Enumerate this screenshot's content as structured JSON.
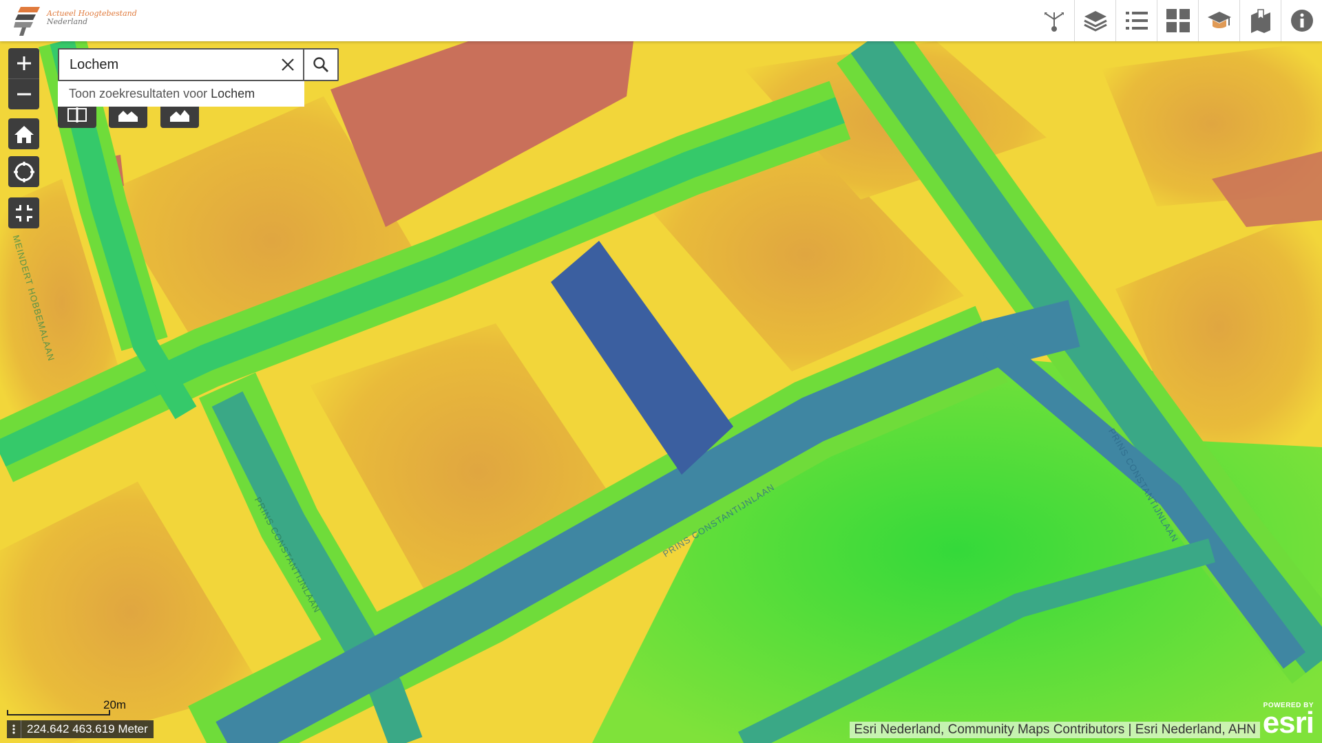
{
  "app": {
    "logo_line1": "Actueel Hoogtebestand",
    "logo_line2": "Nederland"
  },
  "toolbar": [
    {
      "name": "share-icon",
      "label": "Delen"
    },
    {
      "name": "layers-icon",
      "label": "Lagen"
    },
    {
      "name": "legend-icon",
      "label": "Legenda"
    },
    {
      "name": "basemap-gallery-icon",
      "label": "Basiskaarten"
    },
    {
      "name": "education-icon",
      "label": "Educatie"
    },
    {
      "name": "bookmark-icon",
      "label": "Bladwijzers"
    },
    {
      "name": "info-icon",
      "label": "Info"
    }
  ],
  "search": {
    "value": "Lochem",
    "suggestion_prefix": "Toon zoekresultaten voor",
    "suggestion_term": "Lochem"
  },
  "map": {
    "scale_label": "20m",
    "coordinates": "224.642 463.619 Meter",
    "attribution": "Esri Nederland, Community Maps Contributors | Esri Nederland, AHN",
    "powered_by": "POWERED BY",
    "esri_logo": "esri",
    "street_labels": [
      "MEINDERT HOBBEMALAAN",
      "PRINS CONSTANTIJNLAAN",
      "PRINS CONSTANTIJNLAAN",
      "PRINS CONSTANTIJNLAAN"
    ]
  },
  "colors": {
    "high": "#c9705a",
    "mid_high": "#e0a640",
    "mid": "#f2d63a",
    "low": "#4cd63a",
    "road": "#3aa886",
    "lowest": "#3b5fa0",
    "panel": "#3d3d3d"
  }
}
